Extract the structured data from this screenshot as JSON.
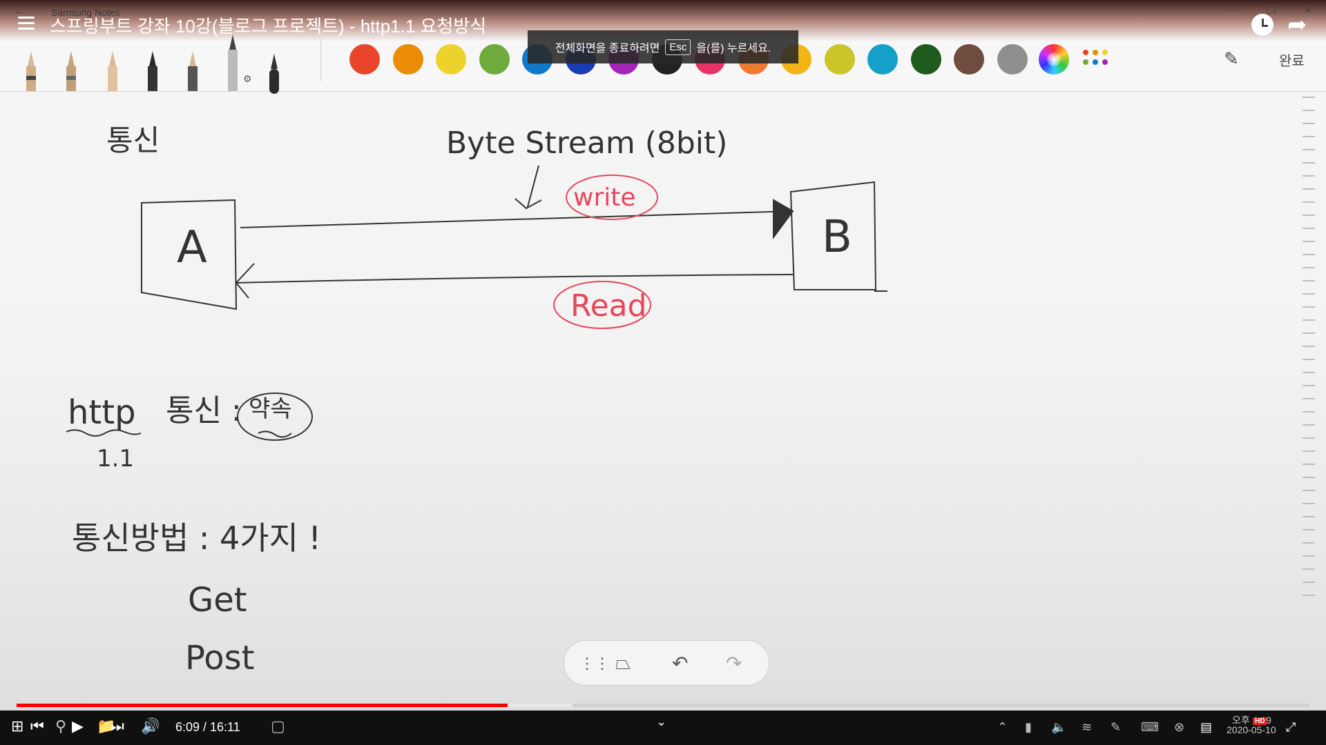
{
  "window": {
    "app_name": "Samsung Notes",
    "video_title": "스프링부트 강좌 10강(블로그 프로젝트) - http1.1 요청방식"
  },
  "toast": {
    "before_key": "전체화면을 종료하려면",
    "key": "Esc",
    "after_key": "을(를) 누르세요."
  },
  "toolbar": {
    "done_label": "완료",
    "colors": [
      "#e8452b",
      "#eb8c06",
      "#ecd22a",
      "#6faa3c",
      "#1178cc",
      "#1b3db3",
      "#a125b6",
      "#222222",
      "#e63469",
      "#ee7a33",
      "#f3b515",
      "#c9c52a",
      "#14a0c8",
      "#1f5a1e",
      "#6f4c3e",
      "#8f8f8f"
    ]
  },
  "note": {
    "heading_top": "통신",
    "byte_stream": "Byte Stream (8bit)",
    "write": "write",
    "read": "Read",
    "box_a": "A",
    "box_b": "B",
    "http_label": "http",
    "http_version": "1.1",
    "http_suffix": "통신 :",
    "promise": "약속",
    "methods_label": "통신방법 : 4가지 !",
    "method_get": "Get",
    "method_post": "Post"
  },
  "player": {
    "time_display": "6:09 / 16:11",
    "progress_played": 0.38,
    "progress_buffered": 0.43
  },
  "taskbar": {
    "clock_time": "오후 6:09",
    "clock_date": "2020-05-10",
    "hd": "HD"
  }
}
